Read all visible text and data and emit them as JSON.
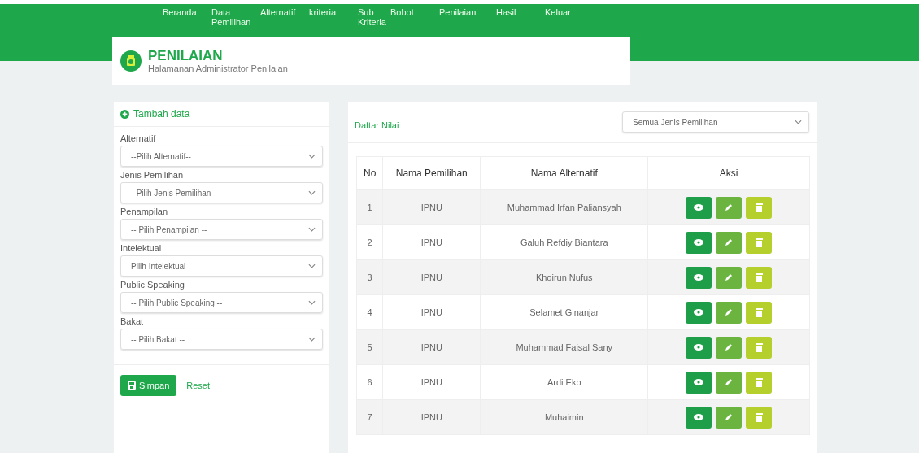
{
  "nav": [
    {
      "label": "Beranda"
    },
    {
      "label": "Data Pemilihan"
    },
    {
      "label": "Alternatif"
    },
    {
      "label": "kriteria"
    },
    {
      "label": "Sub Kriteria"
    },
    {
      "label": "Bobot"
    },
    {
      "label": "Penilaian"
    },
    {
      "label": "Hasil"
    },
    {
      "label": "Keluar"
    }
  ],
  "header": {
    "title": "PENILAIAN",
    "subtitle": "Halamanan Administrator Penilaian"
  },
  "form": {
    "title": "Tambah data",
    "fields": [
      {
        "label": "Alternatif",
        "value": "--Pilih Alternatif--"
      },
      {
        "label": "Jenis Pemilihan",
        "value": "--Pilih Jenis Pemilihan--"
      },
      {
        "label": "Penampilan",
        "value": "-- Pilih Penampilan --"
      },
      {
        "label": "Intelektual",
        "value": "Pilih Intelektual"
      },
      {
        "label": "Public Speaking",
        "value": "-- Pilih Public Speaking --"
      },
      {
        "label": "Bakat",
        "value": "-- Pilih Bakat --"
      }
    ],
    "save": "Simpan",
    "reset": "Reset"
  },
  "list": {
    "title": "Daftar Nilai",
    "filter": "Semua Jenis Pemilihan",
    "columns": [
      "No",
      "Nama Pemilihan",
      "Nama Alternatif",
      "Aksi"
    ],
    "rows": [
      {
        "no": "1",
        "pemilihan": "IPNU",
        "alternatif": "Muhammad Irfan Paliansyah"
      },
      {
        "no": "2",
        "pemilihan": "IPNU",
        "alternatif": "Galuh Refdiy Biantara"
      },
      {
        "no": "3",
        "pemilihan": "IPNU",
        "alternatif": "Khoirun Nufus"
      },
      {
        "no": "4",
        "pemilihan": "IPNU",
        "alternatif": "Selamet Ginanjar"
      },
      {
        "no": "5",
        "pemilihan": "IPNU",
        "alternatif": "Muhammad Faisal Sany"
      },
      {
        "no": "6",
        "pemilihan": "IPNU",
        "alternatif": "Ardi Eko"
      },
      {
        "no": "7",
        "pemilihan": "IPNU",
        "alternatif": "Muhaimin"
      }
    ]
  }
}
